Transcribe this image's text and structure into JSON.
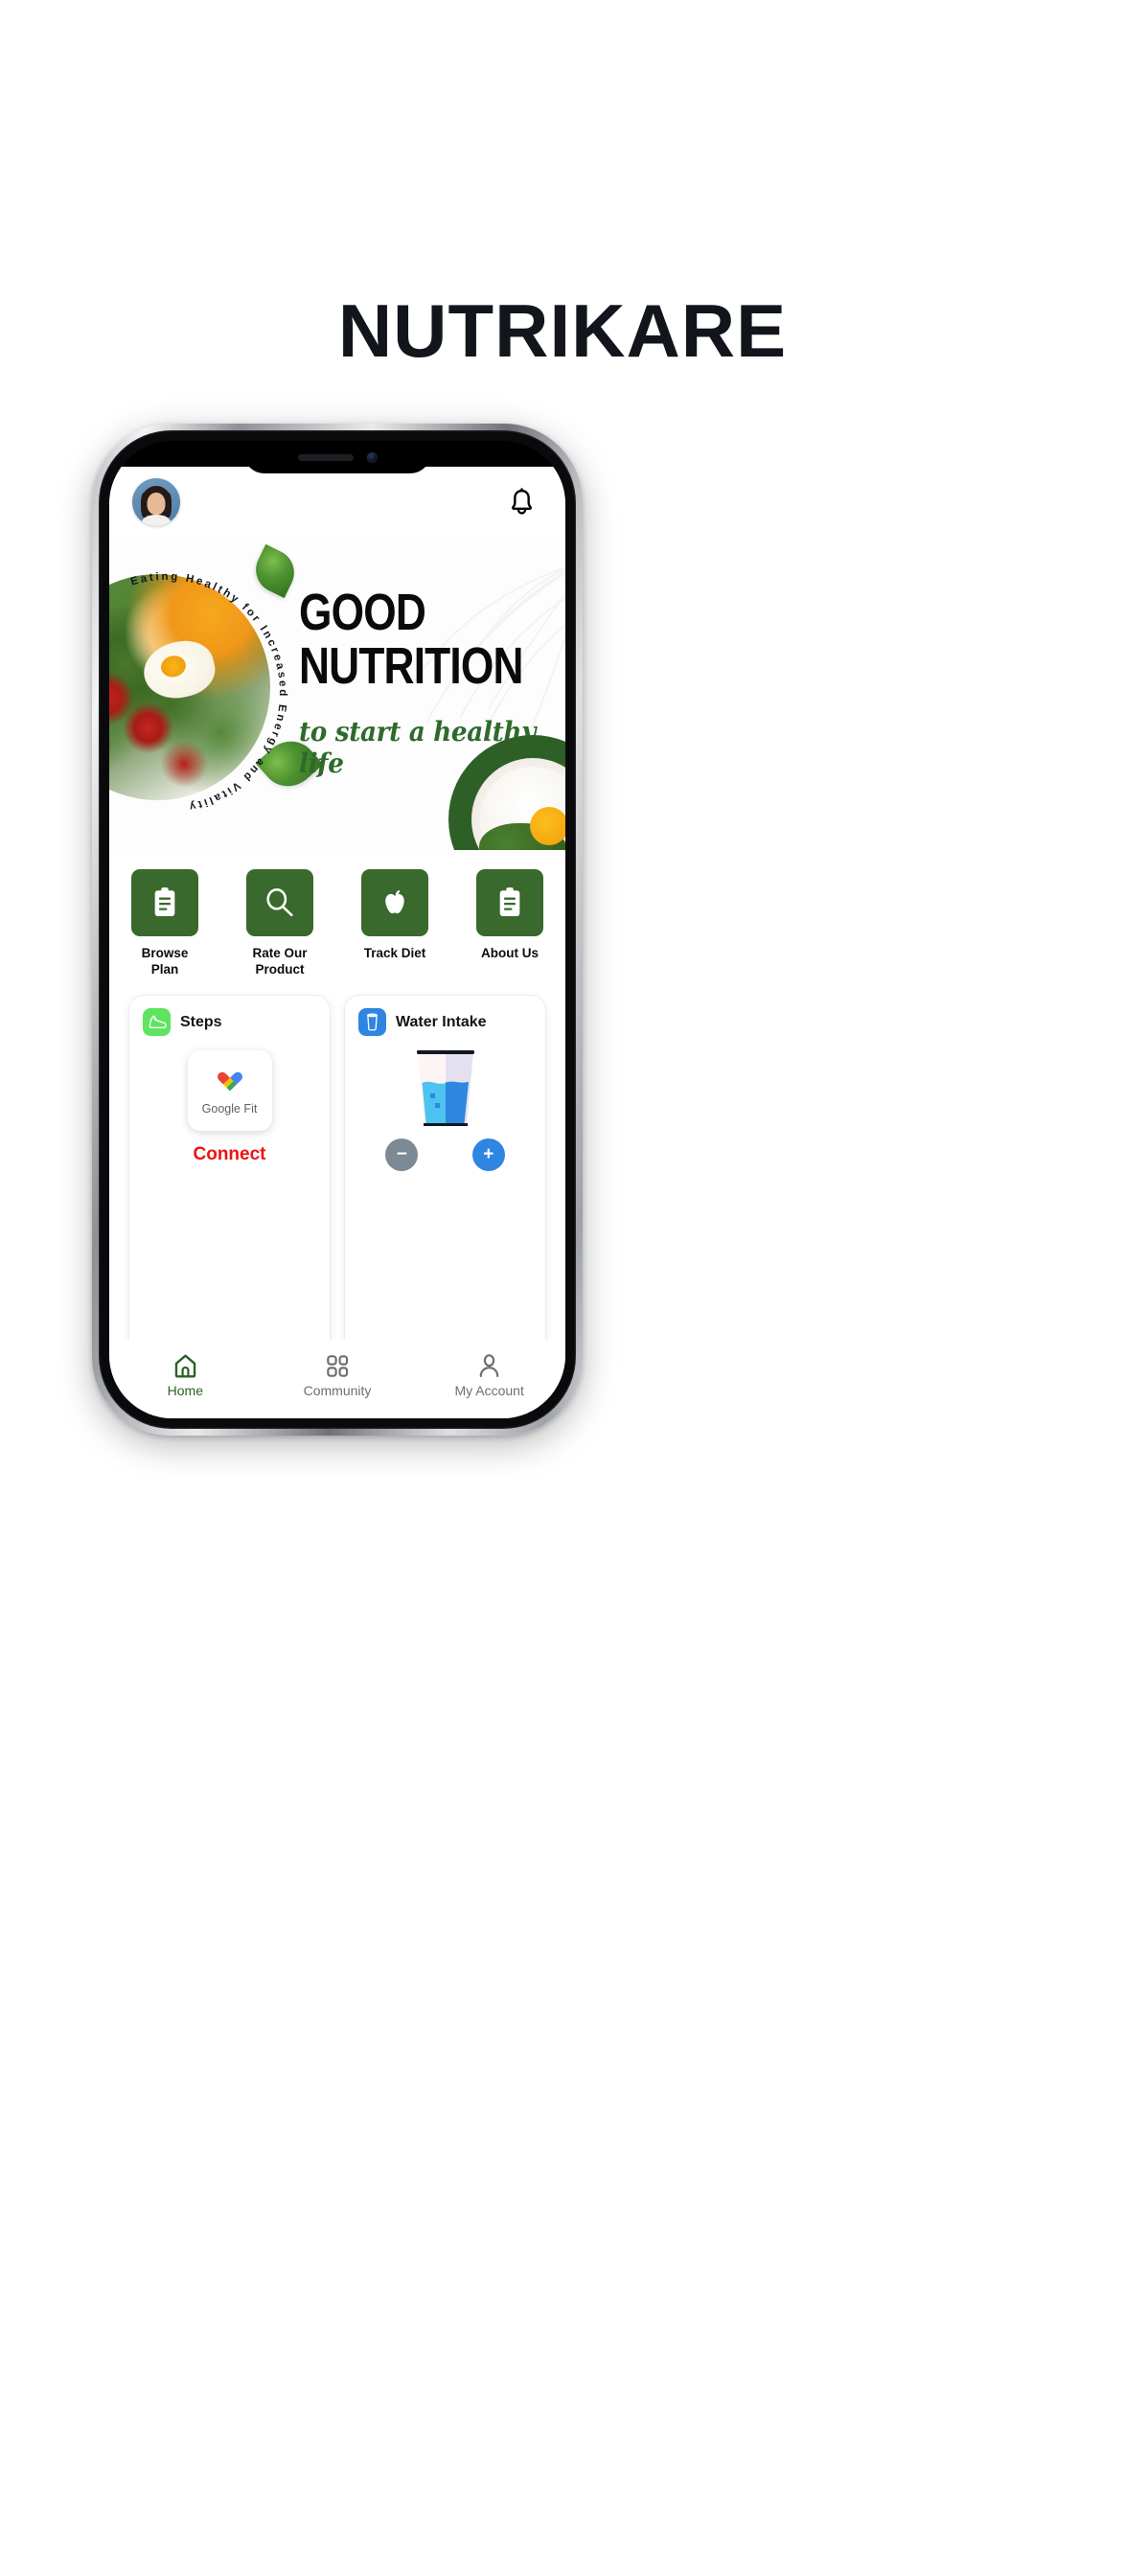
{
  "page": {
    "title": "NUTRIKARE",
    "background_color": "#ffffff",
    "title_color": "#12161c"
  },
  "colors": {
    "brand_green": "#39692d",
    "hero_bowl_green": "#2e5f27",
    "script_green": "#2f6a2c",
    "connect_red": "#ee1111",
    "steps_icon_green": "#5ee45e",
    "water_icon_blue": "#2e86e0",
    "nav_active": "#2c6026",
    "nav_inactive": "#6b6f73"
  },
  "app": {
    "header": {
      "avatar_name": "user-avatar",
      "bell_icon": "bell-icon"
    },
    "hero": {
      "circular_text": "Eating Healthy for Increased Energy and Vitality",
      "title_line_1": "GOOD",
      "title_line_2": "NUTRITION",
      "script_line": "to start a healthy life",
      "salad_image_alt": "salad-with-poached-egg",
      "bowl_image_alt": "rice-bowl-with-egg-and-greens"
    },
    "quick_actions": [
      {
        "label": "Browse Plan",
        "icon": "clipboard-icon"
      },
      {
        "label": "Rate Our Product",
        "icon": "magnifier-icon"
      },
      {
        "label": "Track Diet",
        "icon": "apple-icon"
      },
      {
        "label": "About Us",
        "icon": "clipboard-icon"
      }
    ],
    "widgets": [
      {
        "title": "Steps",
        "icon": "shoe-icon",
        "provider_label": "Google Fit",
        "provider_icon": "google-fit-heart-icon",
        "action_label": "Connect"
      },
      {
        "title": "Water Intake",
        "icon": "water-glass-icon",
        "illustration": "water-glass-illustration",
        "decrement_label": "−",
        "increment_label": "+"
      }
    ],
    "bottom_nav": [
      {
        "label": "Home",
        "icon": "home-icon",
        "active": true
      },
      {
        "label": "Community",
        "icon": "grid-icon",
        "active": false
      },
      {
        "label": "My Account",
        "icon": "person-icon",
        "active": false
      }
    ]
  }
}
